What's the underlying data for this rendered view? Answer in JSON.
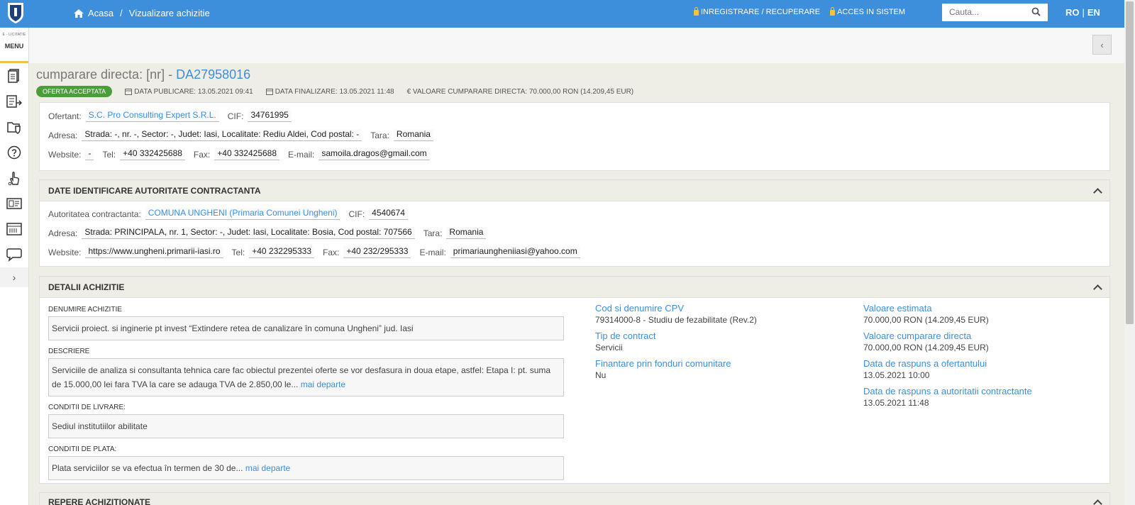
{
  "header": {
    "breadcrumb_home": "Acasa",
    "breadcrumb_sep": "/",
    "breadcrumb_current": "Vizualizare achizitie",
    "link_register": "INREGISTRARE / RECUPERARE",
    "link_login": "ACCES IN SISTEM",
    "search_placeholder": "Cauta...",
    "lang_ro": "RO",
    "lang_sep": "|",
    "lang_en": "EN"
  },
  "sidemenu": {
    "brand_small": "E - LICITATIE",
    "label": "MENU",
    "items": [
      "document-icon",
      "export-icon",
      "folder-shield-icon",
      "help-icon",
      "touch-icon",
      "id-card-icon",
      "catalog-icon",
      "chat-icon"
    ],
    "expand": "›"
  },
  "title": {
    "prefix": "cumparare directa: [nr] - ",
    "code": "DA27958016",
    "status": "OFERTA ACCEPTATA",
    "published": "DATA PUBLICARE: 13.05.2021 09:41",
    "finalized": "DATA FINALIZARE: 13.05.2021 11:48",
    "value": "€ VALOARE CUMPARARE DIRECTA: 70.000,00  RON (14.209,45  EUR)"
  },
  "ofertant": {
    "label_name": "Ofertant:",
    "name": "S.C. Pro Consulting Expert S.R.L.",
    "label_cif": "CIF:",
    "cif": "34761995",
    "label_address": "Adresa:",
    "address": "Strada: -, nr. -, Sector: -, Judet: Iasi, Localitate: Rediu Aldei, Cod postal: -",
    "label_country": "Tara:",
    "country": "Romania",
    "label_website": "Website:",
    "website": "-",
    "label_tel": "Tel:",
    "tel": "+40 332425688",
    "label_fax": "Fax:",
    "fax": "+40 332425688",
    "label_email": "E-mail:",
    "email": "samoila.dragos@gmail.com"
  },
  "autoritate": {
    "heading": "DATE IDENTIFICARE AUTORITATE CONTRACTANTA",
    "label_name": "Autoritatea contractanta:",
    "name": "COMUNA UNGHENI (Primaria Comunei Ungheni)",
    "label_cif": "CIF:",
    "cif": "4540674",
    "label_address": "Adresa:",
    "address": "Strada: PRINCIPALA, nr. 1, Sector: -, Judet: Iasi, Localitate: Bosia, Cod postal: 707566",
    "label_country": "Tara:",
    "country": "Romania",
    "label_website": "Website:",
    "website": "https://www.ungheni.primarii-iasi.ro",
    "label_tel": "Tel:",
    "tel": "+40 232295333",
    "label_fax": "Fax:",
    "fax": "+40 232/295333",
    "label_email": "E-mail:",
    "email": "primariaungheniiasi@yahoo.com"
  },
  "detalii": {
    "heading": "DETALII ACHIZITIE",
    "denumire_label": "DENUMIRE ACHIZITIE",
    "denumire": "Servicii proiect. si inginerie pt invest “Extindere retea de canalizare în comuna Ungheni” jud. Iasi",
    "descriere_label": "DESCRIERE",
    "descriere": "Serviciile de analiza si consultanta tehnica care fac obiectul prezentei oferte se vor desfasura in doua etape, astfel: Etapa I: pt. suma de 15.000,00 lei fara TVA la care se adauga TVA de 2.850,00 le...",
    "more": "mai departe",
    "livrare_label": "CONDITII DE LIVRARE:",
    "livrare": "Sediul institutiilor abilitate",
    "plata_label": "CONDITII DE PLATA:",
    "plata": "Plata serviciilor se va efectua în termen de 30 de...",
    "cpv_label": "Cod si denumire CPV",
    "cpv": "79314000-8 - Studiu de fezabilitate (Rev.2)",
    "tip_label": "Tip de contract",
    "tip": "Servicii",
    "fonduri_label": "Finantare prin fonduri comunitare",
    "fonduri": "Nu",
    "estimata_label": "Valoare estimata",
    "estimata": "70.000,00  RON (14.209,45  EUR)",
    "cumparare_label": "Valoare cumparare directa",
    "cumparare": "70.000,00  RON (14.209,45  EUR)",
    "raspuns_of_label": "Data de raspuns a ofertantului",
    "raspuns_of": "13.05.2021 10:00",
    "raspuns_aut_label": "Data de raspuns a autoritatii contractante",
    "raspuns_aut": "13.05.2021 11:48"
  },
  "repere": {
    "heading": "REPERE ACHIZITIONATE"
  }
}
